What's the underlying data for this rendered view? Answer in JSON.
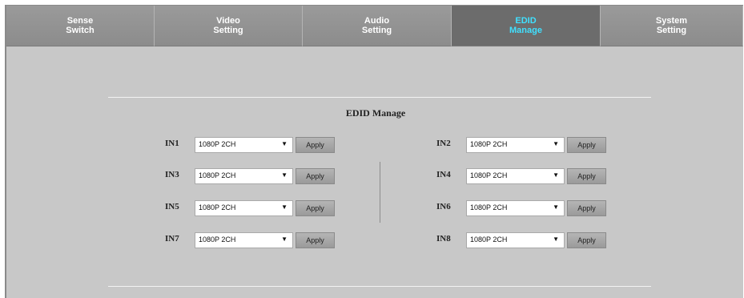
{
  "tabs": [
    {
      "label": "Sense\nSwitch",
      "active": false
    },
    {
      "label": "Video\nSetting",
      "active": false
    },
    {
      "label": "Audio\nSetting",
      "active": false
    },
    {
      "label": "EDID\nManage",
      "active": true
    },
    {
      "label": "System\nSetting",
      "active": false
    }
  ],
  "section": {
    "title": "EDID Manage"
  },
  "inputs": [
    {
      "label": "IN1",
      "value": "1080P 2CH",
      "apply": "Apply"
    },
    {
      "label": "IN2",
      "value": "1080P 2CH",
      "apply": "Apply"
    },
    {
      "label": "IN3",
      "value": "1080P 2CH",
      "apply": "Apply"
    },
    {
      "label": "IN4",
      "value": "1080P 2CH",
      "apply": "Apply"
    },
    {
      "label": "IN5",
      "value": "1080P 2CH",
      "apply": "Apply"
    },
    {
      "label": "IN6",
      "value": "1080P 2CH",
      "apply": "Apply"
    },
    {
      "label": "IN7",
      "value": "1080P 2CH",
      "apply": "Apply"
    },
    {
      "label": "IN8",
      "value": "1080P 2CH",
      "apply": "Apply"
    }
  ],
  "icons": {
    "dropdown": "dropdown-arrow-icon"
  },
  "colors": {
    "active_tab_text": "#40e0ff",
    "tab_bg": "#8c8c8c",
    "panel_bg": "#c8c8c8"
  }
}
